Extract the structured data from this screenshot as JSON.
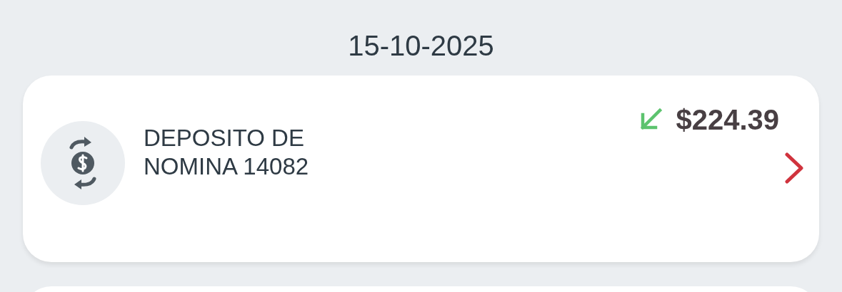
{
  "date": "15-10-2025",
  "transactions": [
    {
      "description": "DEPOSITO DE NOMINA 14082",
      "amount": "$224.39",
      "kind": "incoming"
    }
  ]
}
